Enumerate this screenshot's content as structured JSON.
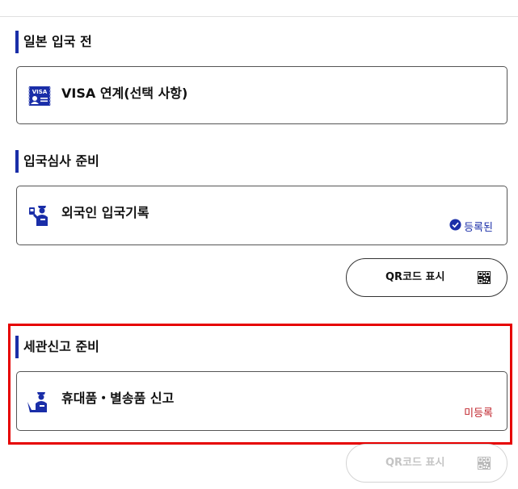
{
  "sections": [
    {
      "title": "일본 입국 전",
      "card": {
        "label": "VISA 연계(선택 사항)",
        "icon": "visa-icon"
      }
    },
    {
      "title": "입국심사 준비",
      "card": {
        "label": "외국인 입국기록",
        "icon": "immigration-officer-icon",
        "status": "등록된"
      },
      "qr_button": {
        "label": "QR코드 표시",
        "enabled": true
      }
    },
    {
      "title": "세관신고 준비",
      "card": {
        "label": "휴대품・별송품 신고",
        "icon": "customs-officer-icon",
        "status": "미등록"
      },
      "qr_button": {
        "label": "QR코드 표시",
        "enabled": false
      }
    }
  ],
  "colors": {
    "accent": "#1a2ea8",
    "registered": "#1a2ea8",
    "unregistered": "#c0262d",
    "highlight": "#e60000"
  }
}
